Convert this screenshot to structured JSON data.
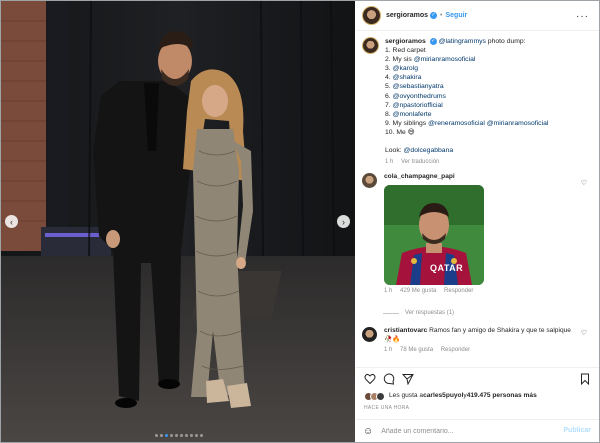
{
  "post": {
    "username": "sergioramos",
    "verified_icon": "verified-badge-icon",
    "separator": "•",
    "follow_label": "Seguir",
    "more_label": "···"
  },
  "caption": {
    "username": "sergioramos",
    "intro_mention": "@latingrammys",
    "intro_text": " photo dump:",
    "lines": [
      {
        "prefix": "1. Red carpet",
        "mention": ""
      },
      {
        "prefix": "2. My sis ",
        "mention": "@mirianramosoficial"
      },
      {
        "prefix": "3. ",
        "mention": "@karolg"
      },
      {
        "prefix": "4. ",
        "mention": "@shakira"
      },
      {
        "prefix": "5. ",
        "mention": "@sebastianyatra"
      },
      {
        "prefix": "6. ",
        "mention": "@ovyonthedrums"
      },
      {
        "prefix": "7. ",
        "mention": "@npastoriofficial"
      },
      {
        "prefix": "8. ",
        "mention": "@monlaferte"
      },
      {
        "prefix": "9. My siblings ",
        "mention": "@reneramosoficial @mirianramosoficial"
      },
      {
        "prefix": "10. Me ",
        "mention": ""
      }
    ],
    "emoji": "😄",
    "look_label": "Look: ",
    "look_mention": "@dolcegabbana",
    "age": "1 h",
    "translate": "Ver traducción"
  },
  "comments": [
    {
      "username": "cola_champagne_papi",
      "gif_text": "QATAR",
      "age": "1 h",
      "likes": "429 Me gusta",
      "reply": "Responder",
      "view_replies": "Ver respuestas (1)"
    },
    {
      "username": "cristiantovarc",
      "text": "Ramos fan y amigo de Shakira y que te salpique",
      "emojis": "🥀🔥",
      "age": "1 h",
      "likes": "78 Me gusta",
      "reply": "Responder"
    }
  ],
  "footer": {
    "likes_prefix": "Les gusta a ",
    "likes_user": "carles5puyol",
    "likes_mid": " y ",
    "likes_count": "419.475 personas más",
    "time": "HACE UNA HORA",
    "comment_placeholder": "Añade un comentario...",
    "publish_label": "Publicar"
  },
  "colors": {
    "accent": "#3897f0",
    "mention": "#00376b",
    "muted": "#8e8e8e"
  }
}
